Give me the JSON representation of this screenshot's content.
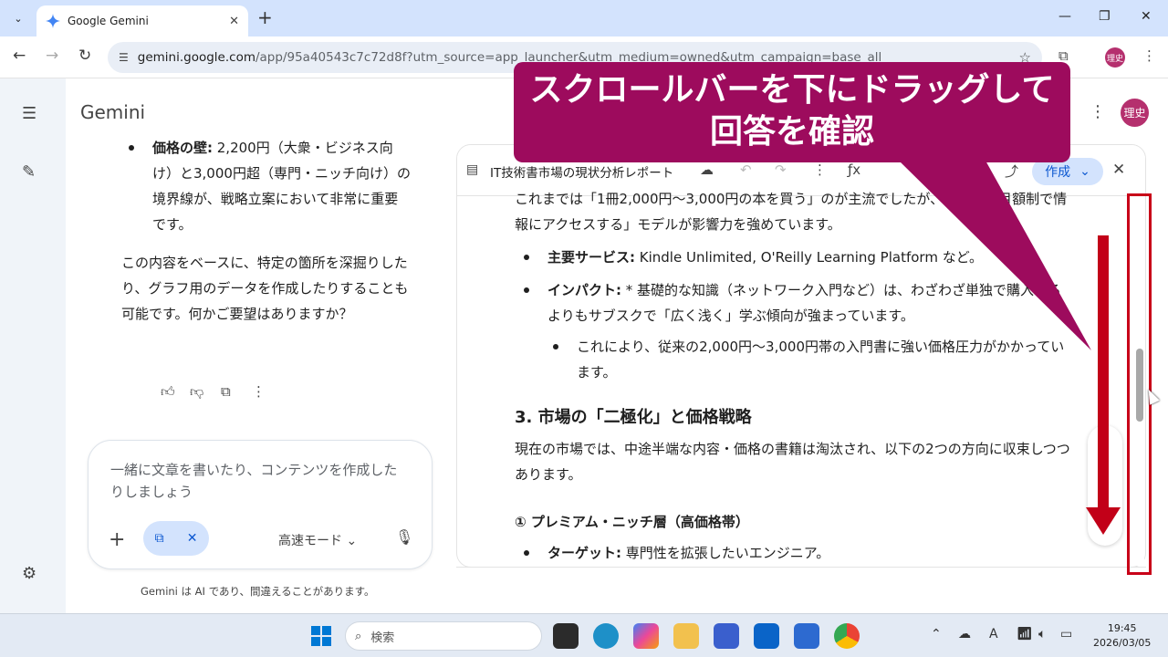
{
  "browser": {
    "tab_title": "Google Gemini",
    "url_host": "gemini.google.com",
    "url_rest": "/app/95a40543c7c72d8f?utm_source=app_launcher&utm_medium=owned&utm_campaign=base_all",
    "profile_initials": "理史"
  },
  "app": {
    "brand": "Gemini",
    "avatar": "理史"
  },
  "chat": {
    "bullet_label": "価格の壁:",
    "bullet_text": " 2,200円（大衆・ビジネス向け）と3,000円超（専門・ニッチ向け）の境界線が、戦略立案において非常に重要です。",
    "paragraph": "この内容をベースに、特定の箇所を深掘りしたり、グラフ用のデータを作成したりすることも可能です。何かご要望はありますか？"
  },
  "input": {
    "placeholder": "一緒に文章を書いたり、コンテンツを作成したりしましょう",
    "mode": "高速モード",
    "disclaimer": "Gemini は AI であり、間違えることがあります。"
  },
  "canvas": {
    "title": "IT技術書市場の現状分析レポート",
    "create_label": "作成",
    "intro": "これまでは「1冊2,000円〜3,000円の本を買う」のが主流でしたが、現在は「月額制で情報にアクセスする」モデルが影響力を強めています。",
    "item1_label": "主要サービス:",
    "item1_text": " Kindle Unlimited, O'Reilly Learning Platform など。",
    "item2_label": "インパクト:",
    "item2_text": " * 基礎的な知識（ネットワーク入門など）は、わざわざ単独で購入するよりもサブスクで「広く浅く」学ぶ傾向が強まっています。",
    "sub_item": "これにより、従来の2,000円〜3,000円帯の入門書に強い価格圧力がかかっています。",
    "section_heading": "3. 市場の「二極化」と価格戦略",
    "section_text": "現在の市場では、中途半端な内容・価格の書籍は淘汰され、以下の2つの方向に収束しつつあります。",
    "subheading": "① プレミアム・ニッチ層（高価格帯）",
    "item3_label": "ターゲット:",
    "item3_text": " 専門性を拡張したいエンジニア。"
  },
  "annotation": {
    "line1": "スクロールバーを下にドラッグして",
    "line2": "回答を確認"
  },
  "taskbar": {
    "search_label": "検索",
    "time": "19:45",
    "date": "2026/03/05"
  },
  "colors": {
    "annotation_bg": "#9d0b5d",
    "highlight_red": "#c80018",
    "accent_blue": "#0b57d0"
  }
}
